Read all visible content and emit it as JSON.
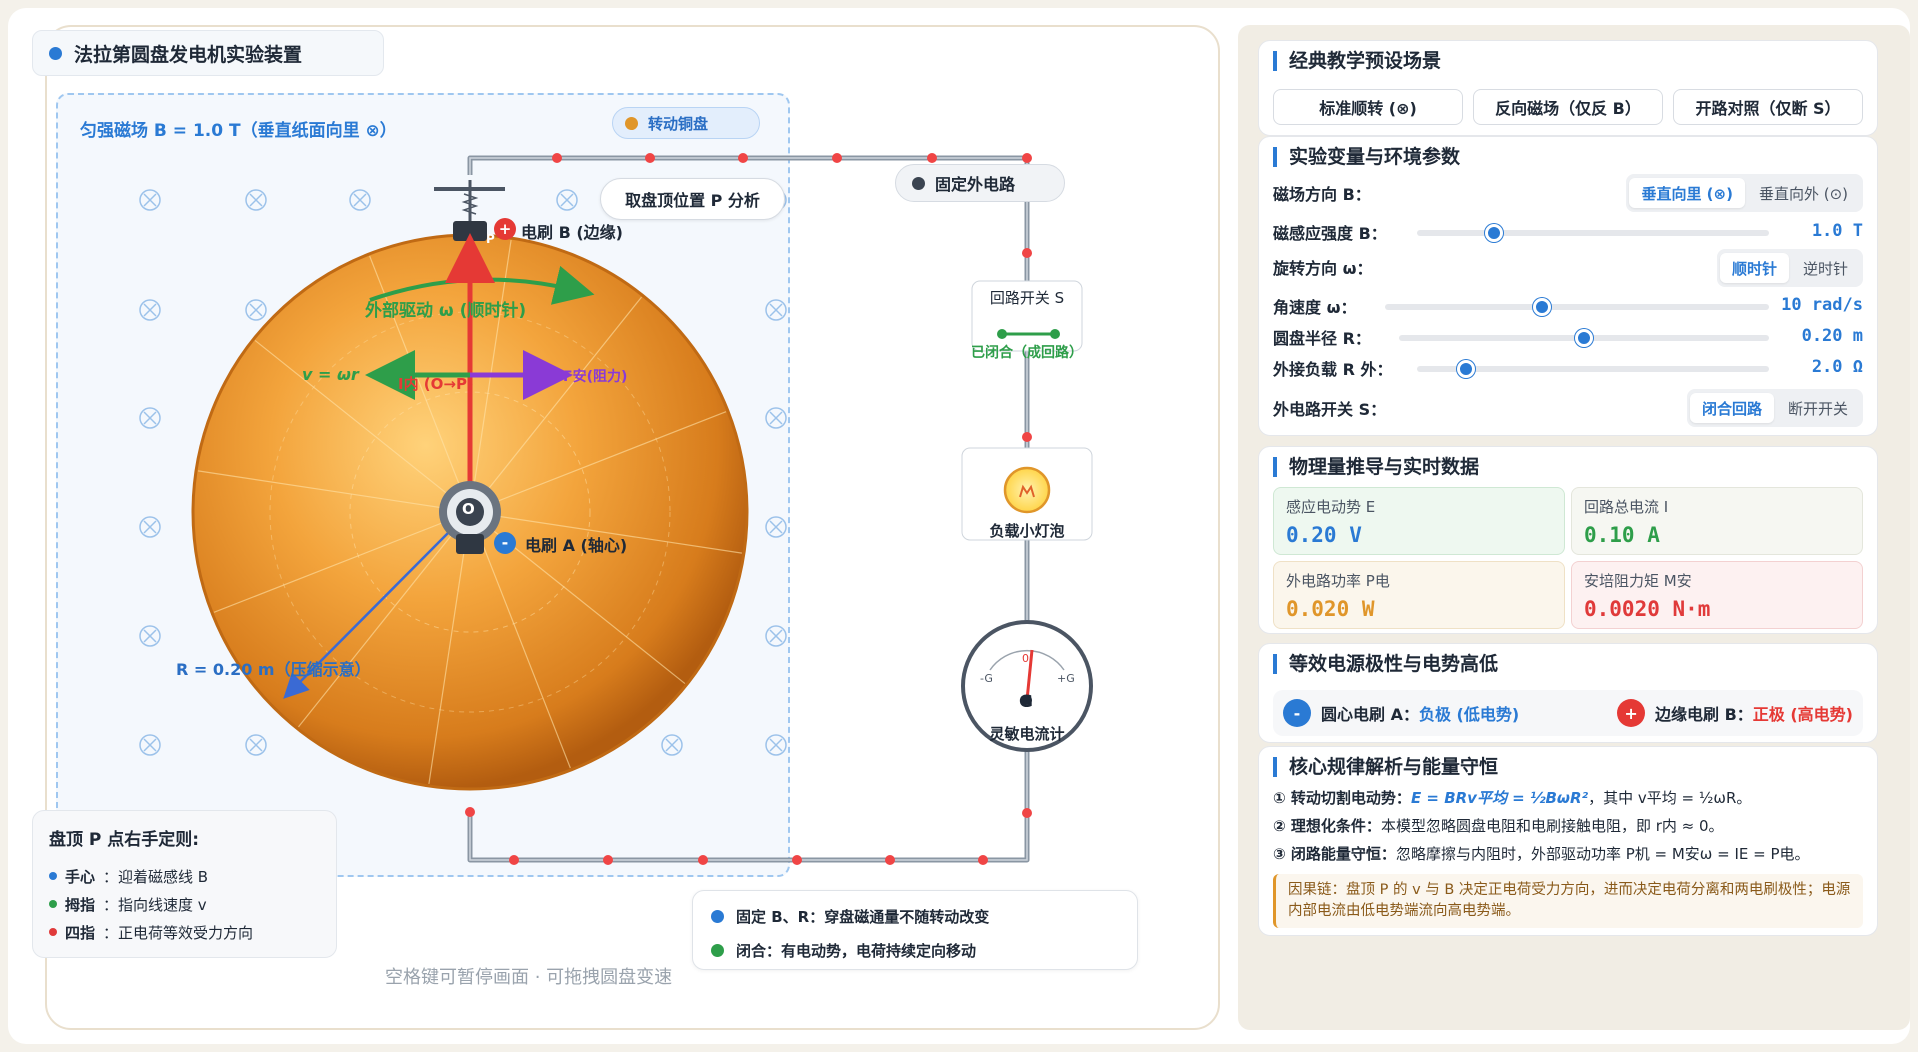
{
  "stage": {
    "title": "法拉第圆盘发电机实验装置",
    "field_label": "匀强磁场 B = 1.0 T（垂直纸面向里 ⊗）",
    "field_symbol": "⊗",
    "disk_tag": "转动铜盘",
    "circuit_tag": "固定外电路",
    "analyze_button": "取盘顶位置 P 分析",
    "brush_b_label": "电刷 B (边缘)",
    "brush_a_label": "电刷 A (轴心)",
    "drive_label": "外部驱动 ω (顺时针)",
    "v_label": "v = ωr",
    "inner_current_label": "I内 (O→P)",
    "force_label": "F安(阻力)",
    "radius_label": "R = 0.20 m（压缩示意）",
    "axis_label": "O",
    "point_label": "P",
    "switch_title": "回路开关 S",
    "switch_state": "已闭合（成回路）",
    "bulb_label": "负载小灯泡",
    "galvanometer_label": "灵敏电流计",
    "galv_minus": "-G",
    "galv_zero": "0",
    "galv_plus": "+G",
    "galv_letter": "G",
    "rule_card": {
      "title": "盘顶 P 点右手定则:",
      "rows": [
        {
          "key": "手心",
          "text": "：迎着磁感线 B",
          "color": "#2a7ad4"
        },
        {
          "key": "拇指",
          "text": "：指向线速度 v",
          "color": "#2e9e4a"
        },
        {
          "key": "四指",
          "text": "：正电荷等效受力方向",
          "color": "#e03a3a"
        }
      ]
    },
    "status": [
      {
        "text": "固定 B、R：穿盘磁通量不随转动改变",
        "color": "#2a7ad4"
      },
      {
        "text": "闭合：有电动势，电荷持续定向移动",
        "color": "#2e9e4a"
      }
    ],
    "hint": "空格键可暂停画面 · 可拖拽圆盘变速"
  },
  "presets": {
    "title": "经典教学预设场景",
    "buttons": [
      "标准顺转 (⊗)",
      "反向磁场（仅反 B）",
      "开路对照（仅断 S）"
    ]
  },
  "params": {
    "title": "实验变量与环境参数",
    "field_dir": {
      "label": "磁场方向 B：",
      "options": [
        "垂直向里 (⊗)",
        "垂直向外 (⊙)"
      ],
      "selected": 0
    },
    "strength": {
      "label": "磁感应强度 B：",
      "value": "1.0 T",
      "fraction": 0.22
    },
    "rot_dir": {
      "label": "旋转方向 ω：",
      "options": [
        "顺时针",
        "逆时针"
      ],
      "selected": 0
    },
    "omega": {
      "label": "角速度 ω：",
      "value": "10 rad/s",
      "fraction": 0.41
    },
    "radius": {
      "label": "圆盘半径 R：",
      "value": "0.20 m",
      "fraction": 0.5
    },
    "load": {
      "label": "外接负载 R 外：",
      "value": "2.0 Ω",
      "fraction": 0.14
    },
    "switch": {
      "label": "外电路开关 S：",
      "options": [
        "闭合回路",
        "断开开关"
      ],
      "selected": 0
    }
  },
  "metrics": {
    "title": "物理量推导与实时数据",
    "items": [
      {
        "label": "感应电动势 E",
        "value": "0.20 V"
      },
      {
        "label": "回路总电流 I",
        "value": "0.10 A"
      },
      {
        "label": "外电路功率 P电",
        "value": "0.020 W"
      },
      {
        "label": "安培阻力矩 M安",
        "value": "0.0020 N·m"
      }
    ],
    "colors": {
      "emf": "#2a7ad4",
      "current": "#2e9e4a",
      "power": "#e0962a",
      "torque": "#e03a3a"
    }
  },
  "polarity": {
    "title": "等效电源极性与电势高低",
    "a_label": "圆心电刷 A：",
    "a_value": "负极 (低电势)",
    "a_sign": "-",
    "b_label": "边缘电刷 B：",
    "b_value": "正极 (高电势)",
    "b_sign": "+"
  },
  "laws": {
    "title": "核心规律解析与能量守恒",
    "l1_head": "① 转动切割电动势：",
    "l1_formula": "E = BRv平均 = ½BωR²",
    "l1_tail": "，其中 v平均 = ½ωR。",
    "l2_head": "② 理想化条件：",
    "l2_text": "本模型忽略圆盘电阻和电刷接触电阻，即 r内 ≈ 0。",
    "l3_head": "③ 闭路能量守恒：",
    "l3_text": "忽略摩擦与内阻时，外部驱动功率 P机 = M安ω = IE = P电。",
    "note": "因果链：盘顶 P 的 v 与 B 决定正电荷受力方向，进而决定电荷分离和两电刷极性；电源内部电流由低电势端流向高电势端。"
  }
}
